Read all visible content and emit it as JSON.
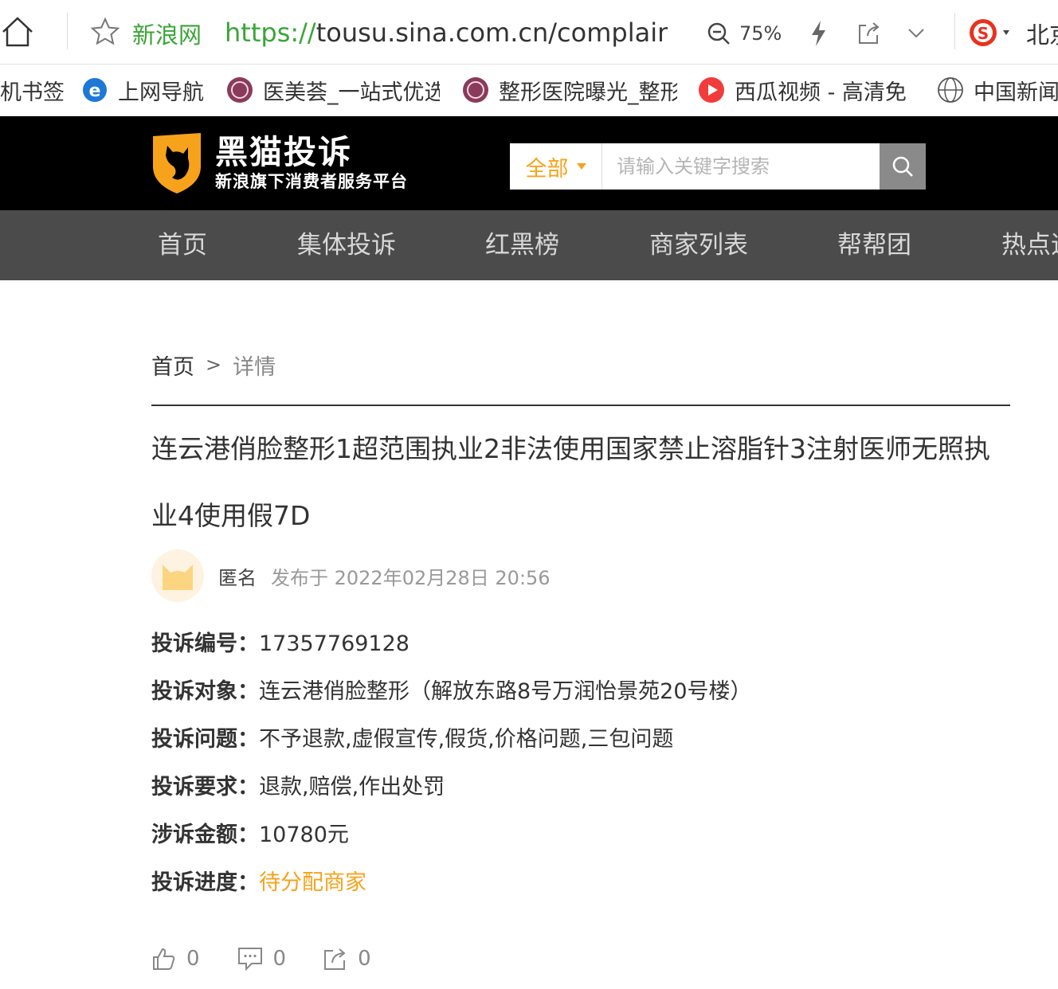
{
  "browser": {
    "site_name": "新浪网",
    "url_proto": "https://",
    "url_rest": "tousu.sina.com.cn/complaint/",
    "zoom": "75%",
    "city": "北京"
  },
  "bookmarks": [
    {
      "label": "机书签",
      "icon": "bookmark-folder-icon"
    },
    {
      "label": "上网导航",
      "icon": "ie-icon"
    },
    {
      "label": "医美荟_一站式优选",
      "icon": "yimeihui-icon"
    },
    {
      "label": "整形医院曝光_整形",
      "icon": "yimeihui-icon"
    },
    {
      "label": "西瓜视频 - 高清免",
      "icon": "xigua-icon"
    },
    {
      "label": "中国新闻",
      "icon": "globe-icon"
    }
  ],
  "header": {
    "logo_title": "黑猫投诉",
    "logo_sub": "新浪旗下消费者服务平台",
    "search_category": "全部",
    "search_placeholder": "请输入关键字搜索"
  },
  "nav": [
    "首页",
    "集体投诉",
    "红黑榜",
    "商家列表",
    "帮帮团",
    "热点追踪"
  ],
  "breadcrumb": {
    "home": "首页",
    "sep": ">",
    "current": "详情"
  },
  "complaint": {
    "title": "连云港俏脸整形1超范围执业2非法使用国家禁止溶脂针3注射医师无照执业4使用假7D",
    "author": "匿名",
    "published": "发布于 2022年02月28日 20:56",
    "fields": [
      {
        "label": "投诉编号：",
        "value": "17357769128"
      },
      {
        "label": "投诉对象：",
        "value": "连云港俏脸整形（解放东路8号万润怡景苑20号楼）"
      },
      {
        "label": "投诉问题：",
        "value": "不予退款,虚假宣传,假货,价格问题,三包问题"
      },
      {
        "label": "投诉要求：",
        "value": "退款,赔偿,作出处罚"
      },
      {
        "label": "涉诉金额：",
        "value": "10780元"
      },
      {
        "label": "投诉进度：",
        "value": "待分配商家"
      }
    ],
    "likes": "0",
    "comments": "0",
    "shares": "0"
  },
  "colors": {
    "accent": "#f7a21b",
    "green": "#3aa536",
    "nav_bg": "#4b4b4b"
  }
}
